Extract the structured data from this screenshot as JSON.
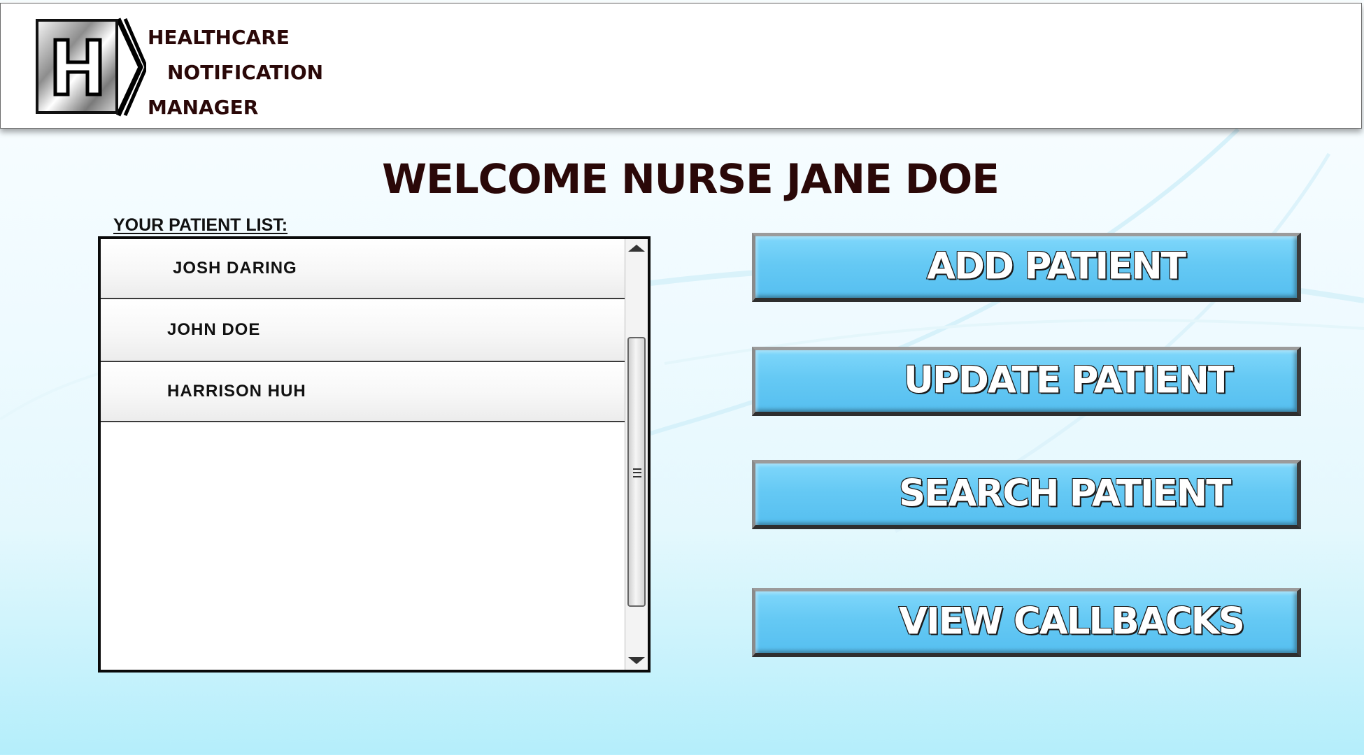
{
  "app": {
    "logo_letter": "H",
    "title_line1": "HEALTHCARE",
    "title_line2": "NOTIFICATION",
    "title_line3": "MANAGER"
  },
  "welcome": {
    "text": "WELCOME NURSE JANE DOE"
  },
  "patient_list": {
    "label": "YOUR PATIENT LIST:",
    "patients": [
      {
        "name": "JOSH DARING"
      },
      {
        "name": "JOHN DOE"
      },
      {
        "name": "HARRISON HUH"
      }
    ]
  },
  "actions": {
    "add_label": "ADD PATIENT",
    "update_label": "UPDATE PATIENT",
    "search_label": "SEARCH PATIENT",
    "callbacks_label": "VIEW CALLBACKS"
  },
  "colors": {
    "button_blue": "#5ec5f2",
    "title_dark": "#2a0808"
  },
  "icons": {
    "logo": "hospital-h-logo-icon",
    "scroll_up": "triangle-up-icon",
    "scroll_down": "triangle-down-icon",
    "scroll_grip": "grip-lines-icon"
  }
}
